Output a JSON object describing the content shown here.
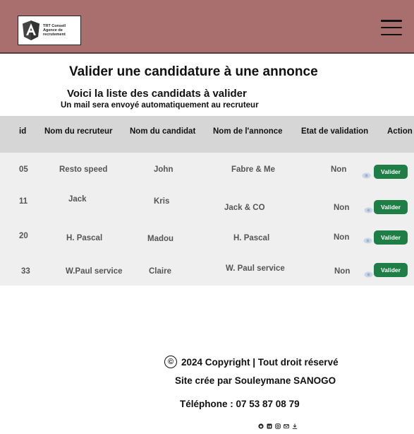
{
  "header": {
    "logo_lines": [
      "TRT Conseil",
      "Agence de",
      "recrutement"
    ]
  },
  "page": {
    "title": "Valider une candidature à une annonce",
    "subtitle": "Voici la liste des candidats à valider",
    "note": "Un mail sera envoyé automatiquement au recruteur"
  },
  "table": {
    "columns": [
      "id",
      "Nom du recruteur",
      "Nom du candidat",
      "Nom de l'annonce",
      "Etat de validation",
      "Action"
    ],
    "rows": [
      {
        "id": "05",
        "recruiter": "Resto speed",
        "candidate": "John",
        "offer": "Fabre & Me",
        "status": "Non",
        "action": "Valider"
      },
      {
        "id": "11",
        "recruiter": "Jack",
        "candidate": "Kris",
        "offer": "Jack & CO",
        "status": "Non",
        "action": "Valider"
      },
      {
        "id": "20",
        "recruiter": "H. Pascal",
        "candidate": "Madou",
        "offer": "H. Pascal",
        "status": "Non",
        "action": "Valider"
      },
      {
        "id": "33",
        "recruiter": "W.Paul service",
        "candidate": "Claire",
        "offer": "W. Paul service",
        "status": "Non",
        "action": "Valider"
      }
    ]
  },
  "footer": {
    "copyright_symbol": "©",
    "copyright": "2024 Copyright | Tout droit réservé",
    "credit": "Site crée par Souleymane SANOGO",
    "phone": "Téléphone : 07 53 87 08 79",
    "social_icons": [
      "github-icon",
      "linkedin-icon",
      "instagram-icon",
      "mail-icon",
      "download-icon"
    ]
  },
  "colors": {
    "header_bg": "#a96f6f",
    "button_green": "#1e7e45",
    "table_head_bg": "#d6d6d6",
    "table_body_bg": "#efefef"
  }
}
